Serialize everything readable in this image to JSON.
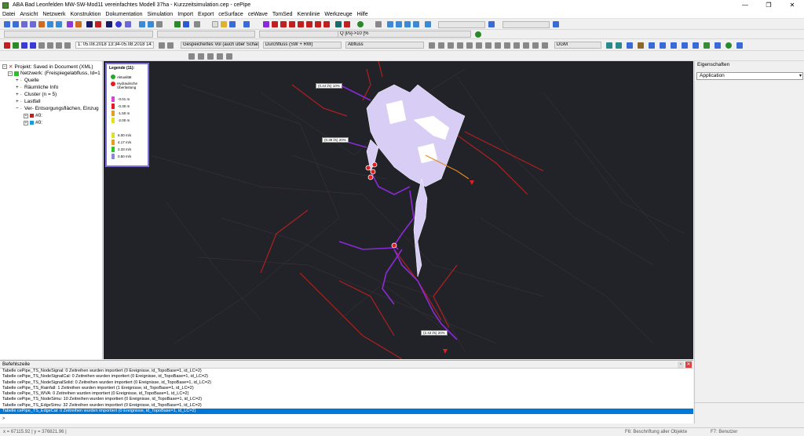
{
  "window": {
    "title": "ABA Bad Leonfelden MW-SW-Mod11 vereinfachtes Modell 37ha - Kurzzeitsimulation.cep - cePipe",
    "minimize": "—",
    "maximize": "❐",
    "close": "✕"
  },
  "menu": [
    "Datei",
    "Ansicht",
    "Netzwerk",
    "Konstruktion",
    "Dokumentation",
    "Simulation",
    "Import",
    "Export",
    "ceSurface",
    "ceWave",
    "TomSed",
    "Kennlinie",
    "Werkzeuge",
    "Hilfe"
  ],
  "toolbar": {
    "q_field": "Q [l/s]->10 [%",
    "time_range": "1: 05.08.2018 13:34-05.08.2018 14:",
    "stored_volume": "Gespeichertes Vol (auch über Schach",
    "flow": "Durchfluss (SW + RW)",
    "outflow": "Abfluss",
    "dgm": "DGM"
  },
  "tree": {
    "root": "Projekt: Saved in Document (XML)",
    "network": "Netzwerk: (Freispiegelabfluss, Id=1",
    "items": [
      "Quelle",
      "Räumliche Info",
      "Cluster (n = 5)",
      "Lastfall",
      "Ver- Entsorgungsflächen, Einzug"
    ],
    "sub_items": [
      "#0:",
      "#0:"
    ]
  },
  "legend": {
    "title": "Legende (11):",
    "status": [
      {
        "label": "Aktualität",
        "color": "#22aa22"
      },
      {
        "label": "Hydraulische Überlastung",
        "color": "#e02020"
      }
    ],
    "depth": [
      {
        "label": "-0.01 m",
        "color": "#e040e0"
      },
      {
        "label": "-0.30 m",
        "color": "#e02020"
      },
      {
        "label": "-1.50 m",
        "color": "#e0a020"
      },
      {
        "label": "-2.00 m",
        "color": "#e0e020"
      }
    ],
    "velocity": [
      {
        "label": "6.00 m/s",
        "color": "#e0e020"
      },
      {
        "label": "4.17 m/s",
        "color": "#e0a020"
      },
      {
        "label": "2.33 m/s",
        "color": "#22cc22"
      },
      {
        "label": "0.50 m/s",
        "color": "#8a8ad0"
      }
    ]
  },
  "map_labels": [
    "(0.44 l/s) 10%",
    "(0.39 l/s) 20%",
    "(2.43 l/s) 20%"
  ],
  "properties": {
    "title": "Eigenschaften",
    "selected": "Application"
  },
  "command": {
    "title": "Befehlszeile",
    "lines": [
      "Tabelle cePipe_TS_NodeSignal: 0 Zeitreihen wurden importiert (0 Ereignisse, id_TopoBase=1, id_LC=2)",
      "Tabelle cePipe_TS_NodeSignalCal: 0 Zeitreihen wurden importiert (0 Ereignisse, id_TopoBase=1, id_LC=2)",
      "Tabelle cePipe_TS_NodeSignalSolid: 0 Zeitreihen wurden importiert (0 Ereignisse, id_TopoBase=1, id_LC=2)",
      "Tabelle cePipe_TS_Rainfall: 1 Zeitreihen wurden importiert (1 Ereignisse, id_TopoBase=1, id_LC=2)",
      "Tabelle cePipe_TS_WVA: 0 Zeitreihen wurden importiert (0 Ereignisse, id_TopoBase=1, id_LC=2)",
      "Tabelle cePipe_TS_NodeSimu: 10 Zeitreihen wurden importiert (0 Ereignisse, id_TopoBase=1, id_LC=2)",
      "Tabelle cePipe_TS_EdgeSimu: 32 Zeitreihen wurden importiert (0 Ereignisse, id_TopoBase=1, id_LC=2)",
      "Tabelle cePipe_TS_EdgeCal: 0 Zeitreihen wurden importiert (0 Ereignisse, id_TopoBase=1, id_LC=2)"
    ],
    "prompt": ">"
  },
  "status": {
    "coords": "x = 67115.92 | y = 376821.96 |",
    "f6": "F6: Beschriftung aller Objekte",
    "f7": "F7: Benutzer"
  }
}
